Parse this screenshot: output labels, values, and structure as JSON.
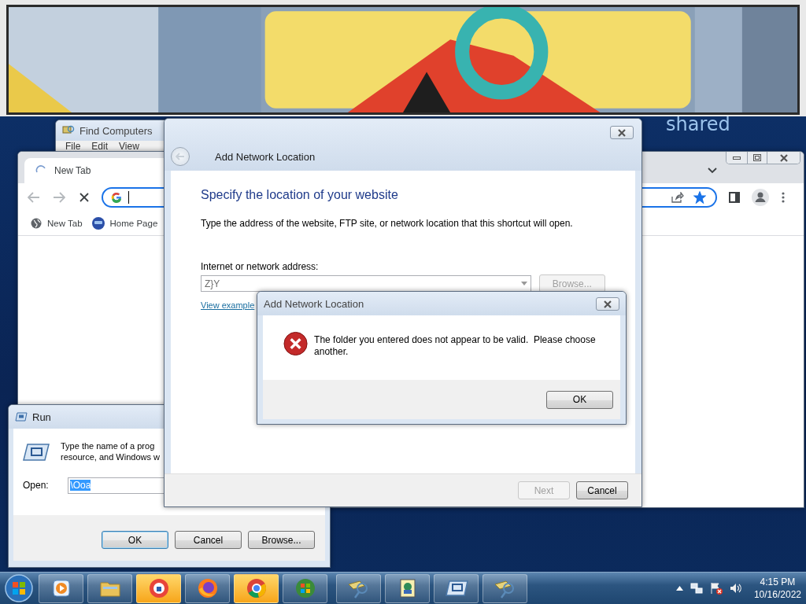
{
  "desktop_label": "shared",
  "find_computers": {
    "title": "Find Computers",
    "menu": [
      "File",
      "Edit",
      "View"
    ]
  },
  "browser": {
    "tab": {
      "title": "New Tab",
      "loading": true
    },
    "bookmarked": true,
    "bookmarks": [
      "New Tab",
      "Home Page"
    ]
  },
  "run": {
    "title": "Run",
    "prompt_lines": [
      "Type the name of a prog",
      "resource, and Windows w"
    ],
    "open_label": "Open:",
    "value": "\\Ooa",
    "value_selected": true,
    "buttons": [
      {
        "label": "OK",
        "default": true
      },
      {
        "label": "Cancel",
        "default": false
      },
      {
        "label": "Browse...",
        "default": false
      }
    ]
  },
  "wizard": {
    "title": "Add Network Location",
    "heading": "Specify the location of your website",
    "description": "Type the address of the website, FTP site, or network location that this shortcut will open.",
    "address_label": "Internet or network address:",
    "address_value": "Z}Y",
    "browse": {
      "label": "Browse...",
      "disabled": true
    },
    "link": "View example",
    "buttons": [
      {
        "label": "Next",
        "disabled": true
      },
      {
        "label": "Cancel",
        "disabled": false
      }
    ]
  },
  "error": {
    "title": "Add Network Location",
    "message": "The folder you entered does not appear to be valid.  Please choose another.",
    "button": "OK"
  },
  "taskbar": {
    "time": "4:15 PM",
    "date": "10/16/2022"
  }
}
